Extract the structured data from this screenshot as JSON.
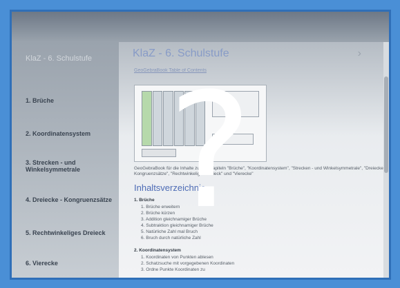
{
  "sidebar": {
    "app_title": "KlaZ - 6. Schulstufe",
    "items": [
      {
        "label": "1. Brüche"
      },
      {
        "label": "2. Koordinatensystem"
      },
      {
        "label": "3. Strecken - und Winkelsymmetrale"
      },
      {
        "label": "4. Dreiecke - Kongruenzsätze"
      },
      {
        "label": "5. Rechtwinkeliges Dreieck"
      },
      {
        "label": "6. Vierecke"
      }
    ]
  },
  "main": {
    "title": "KlaZ - 6. Schulstufe",
    "link": "GeoGebraBook Table of Contents",
    "description": "GeoGebraBook für die Inhalte zu den Kapiteln \"Brüche\", \"Koordinatensystem\", \"Strecken - und Winkelsymmetrale\", \"Dreiecke - Kongruenzsätze\", \"Rechtwinkeliges Dreieck\" und \"Vierecke\"",
    "toc_title": "Inhaltsverzeichnis",
    "sections": [
      {
        "title": "1. Brüche",
        "items": [
          "1. Brüche erweitern",
          "2. Brüche kürzen",
          "3. Addition gleichnamiger Brüche",
          "4. Subtraktion gleichnamiger Brüche",
          "5. Natürliche Zahl mal Bruch",
          "6. Bruch durch natürliche Zahl"
        ]
      },
      {
        "title": "2. Koordinatensystem",
        "items": [
          "1. Koordinaten von Punkten ablesen",
          "2. Schatzsuche mit vorgegebenen Koordinaten",
          "3. Ordne Punkte Koordinaten zu"
        ]
      }
    ]
  },
  "overlay": {
    "glyph": "?",
    "icon": "question-mark-icon"
  }
}
